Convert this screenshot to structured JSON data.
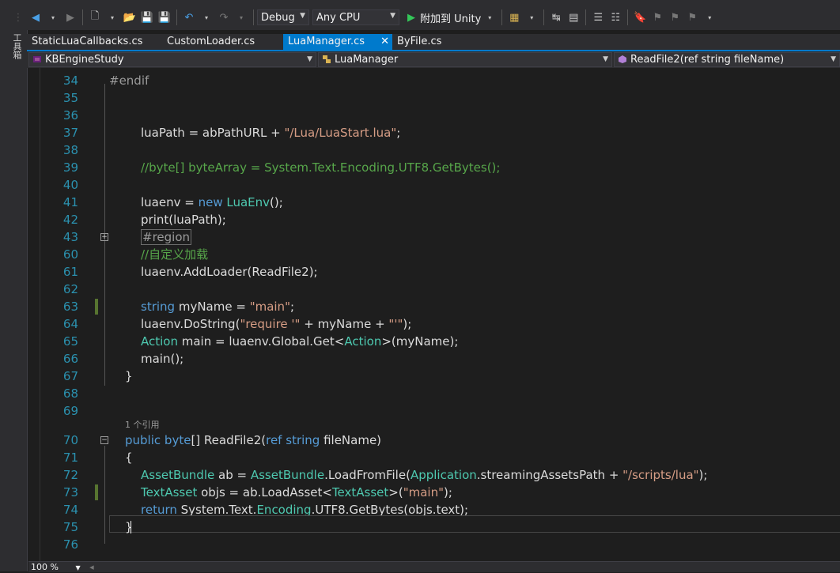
{
  "toolbar": {
    "config": "Debug",
    "platform": "Any CPU",
    "attach_label": "附加到 Unity",
    "icons": [
      "back-icon",
      "forward-icon",
      "new-project-icon",
      "open-icon",
      "save-icon",
      "save-all-icon",
      "undo-icon",
      "redo-icon",
      "play-icon",
      "bookmark-icon"
    ]
  },
  "left_panel": {
    "label": "工具箱"
  },
  "tabs": [
    {
      "label": "StaticLuaCallbacks.cs"
    },
    {
      "label": "CustomLoader.cs"
    },
    {
      "label": "LuaManager.cs",
      "active": true
    },
    {
      "label": "ByFile.cs"
    }
  ],
  "tab_close": "✕",
  "nav": {
    "project": "KBEngineStudy",
    "class": "LuaManager",
    "member": "ReadFile2(ref string fileName)"
  },
  "editor": {
    "references": "1 个引用",
    "lines": [
      {
        "n": "34",
        "text": "#endif"
      },
      {
        "n": "35",
        "text": ""
      },
      {
        "n": "36",
        "text": ""
      },
      {
        "n": "37",
        "text": "luaPath = abPathURL + \"/Lua/LuaStart.lua\";"
      },
      {
        "n": "38",
        "text": ""
      },
      {
        "n": "39",
        "text": "//byte[] byteArray = System.Text.Encoding.UTF8.GetBytes();"
      },
      {
        "n": "40",
        "text": ""
      },
      {
        "n": "41",
        "text": "luaenv = new LuaEnv();"
      },
      {
        "n": "42",
        "text": "print(luaPath);"
      },
      {
        "n": "43",
        "text": "#region"
      },
      {
        "n": "60",
        "text": "//自定义加载"
      },
      {
        "n": "61",
        "text": "luaenv.AddLoader(ReadFile2);"
      },
      {
        "n": "62",
        "text": ""
      },
      {
        "n": "63",
        "text": "string myName = \"main\";"
      },
      {
        "n": "64",
        "text": "luaenv.DoString(\"require '\" + myName + \"'\");"
      },
      {
        "n": "65",
        "text": "Action main = luaenv.Global.Get<Action>(myName);"
      },
      {
        "n": "66",
        "text": "main();"
      },
      {
        "n": "67",
        "text": "}"
      },
      {
        "n": "68",
        "text": ""
      },
      {
        "n": "69",
        "text": ""
      },
      {
        "n": "70",
        "text": "public byte[] ReadFile2(ref string fileName)"
      },
      {
        "n": "71",
        "text": "{"
      },
      {
        "n": "72",
        "text": "AssetBundle ab = AssetBundle.LoadFromFile(Application.streamingAssetsPath + \"/scripts/lua\");"
      },
      {
        "n": "73",
        "text": "TextAsset objs = ab.LoadAsset<TextAsset>(\"main\");"
      },
      {
        "n": "74",
        "text": "return System.Text.Encoding.UTF8.GetBytes(objs.text);"
      },
      {
        "n": "75",
        "text": "}"
      },
      {
        "n": "76",
        "text": ""
      }
    ]
  },
  "status": {
    "zoom": "100 %"
  }
}
